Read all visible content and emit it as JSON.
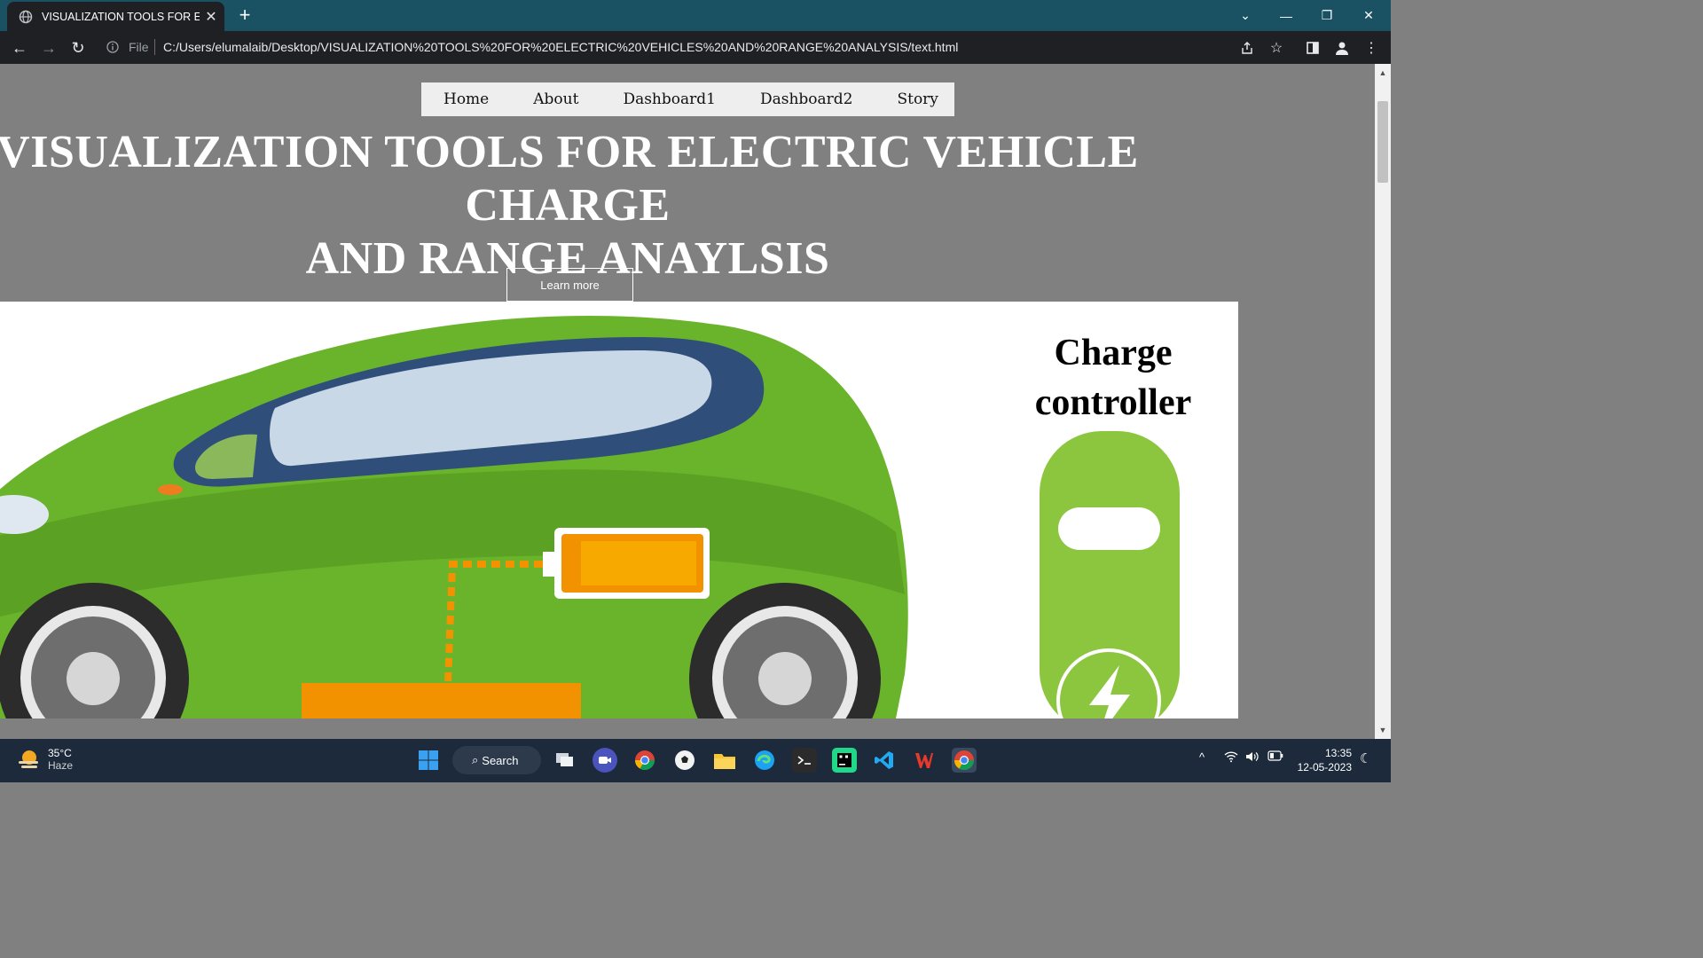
{
  "browser": {
    "tab_title": "VISUALIZATION TOOLS FOR ELEC",
    "tab_close": "✕",
    "new_tab": "+",
    "window_controls": {
      "dropdown": "⌄",
      "minimize": "—",
      "restore": "❐",
      "close": "✕"
    },
    "nav": {
      "back": "←",
      "forward": "→",
      "reload": "↻"
    },
    "file_label": "File",
    "url": "C:/Users/elumalaib/Desktop/VISUALIZATION%20TOOLS%20FOR%20ELECTRIC%20VEHICLES%20AND%20RANGE%20ANALYSIS/text.html"
  },
  "page": {
    "nav_items": [
      "Home",
      "About",
      "Dashboard1",
      "Dashboard2",
      "Story"
    ],
    "hero_title_line1": "VISUALIZATION TOOLS FOR ELECTRIC VEHICLE CHARGE",
    "hero_title_line2": "AND RANGE ANAYLSIS",
    "learn_more": "Learn more",
    "charge_title_line1": "Charge",
    "charge_title_line2": "controller"
  },
  "taskbar": {
    "weather_temp": "35°C",
    "weather_cond": "Haze",
    "search_label": "Search",
    "time": "13:35",
    "date": "12-05-2023",
    "colors": {
      "background": "#1c2a3c"
    }
  },
  "colors": {
    "tabbar": "#1a5163",
    "page_background": "#808080",
    "car_green": "#6ab42c",
    "charger_green": "#8cc63f",
    "battery_orange": "#f39200"
  }
}
